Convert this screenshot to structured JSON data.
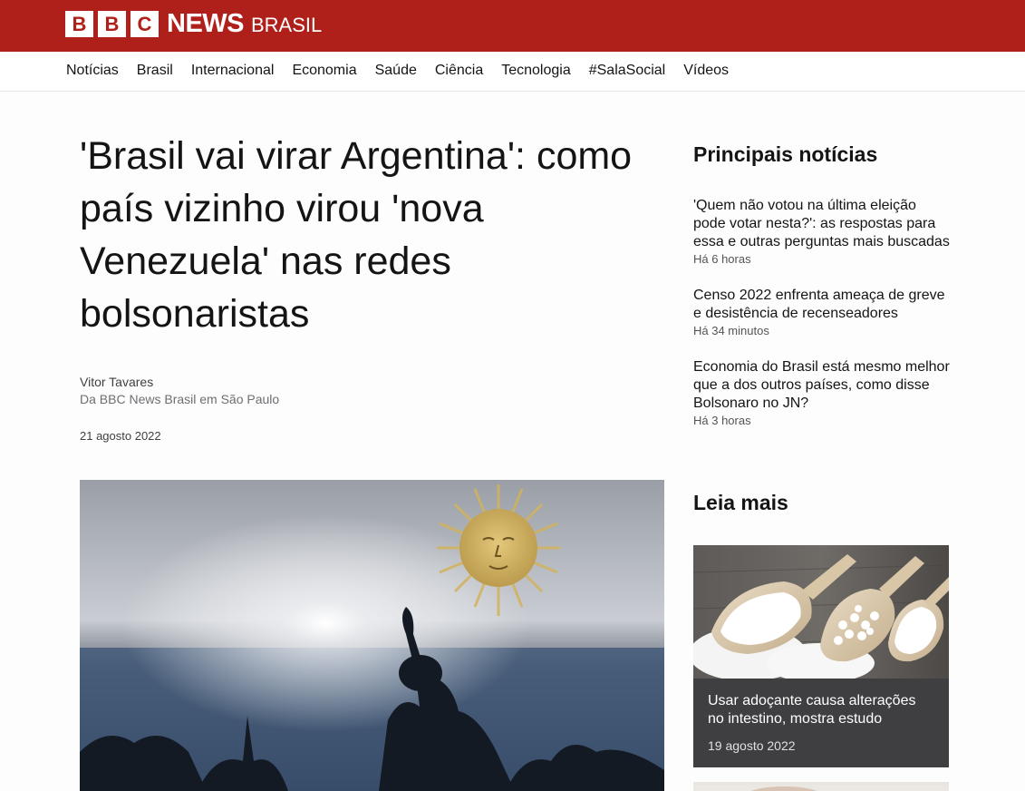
{
  "header": {
    "logo_letters": [
      "B",
      "B",
      "C"
    ],
    "logo_news": "NEWS",
    "logo_edition": "BRASIL",
    "brand_color": "#b0201a"
  },
  "nav": {
    "items": [
      "Notícias",
      "Brasil",
      "Internacional",
      "Economia",
      "Saúde",
      "Ciência",
      "Tecnologia",
      "#SalaSocial",
      "Vídeos"
    ]
  },
  "article": {
    "headline": "'Brasil vai virar Argentina': como país vizinho virou 'nova Venezuela' nas redes bolsonaristas",
    "author": "Vitor Tavares",
    "author_role": "Da BBC News Brasil em São Paulo",
    "date": "21 agosto 2022"
  },
  "sidebar": {
    "top_title": "Principais notícias",
    "top_news": [
      {
        "headline": "'Quem não votou na última eleição pode votar nesta?': as respostas para essa e outras perguntas mais buscadas",
        "time": "Há 6 horas"
      },
      {
        "headline": "Censo 2022 enfrenta ameaça de greve e desistência de recenseadores",
        "time": "Há 34 minutos"
      },
      {
        "headline": "Economia do Brasil está mesmo melhor que a dos outros países, como disse Bolsonaro no JN?",
        "time": "Há 3 horas"
      }
    ],
    "more_title": "Leia mais",
    "more_card": {
      "headline": "Usar adoçante causa alterações no intestino, mostra estudo",
      "date": "19 agosto 2022"
    }
  }
}
